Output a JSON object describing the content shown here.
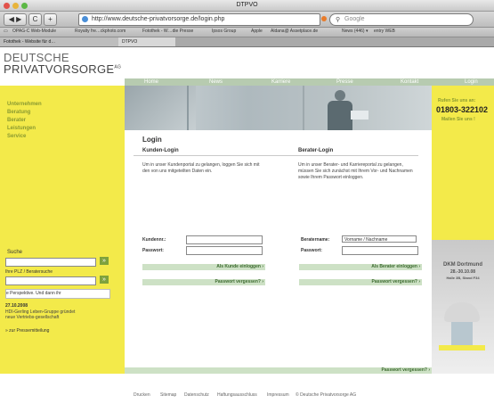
{
  "browser": {
    "window_title": "DTPVO",
    "url": "http://www.deutsche-privatvorsorge.de/login.php",
    "search_placeholder": "Google",
    "back_glyph": "◀ ▶",
    "reload_glyph": "C",
    "add_glyph": "+",
    "bookmarks": [
      "OPAG-C Web-Module",
      "Royalty fre…ckphoto.com",
      "Fotothek - W…die Presse",
      "Ipsos Group",
      "Apple",
      "Aldana@ Assetplace.de",
      "News (446) ▾",
      "entry WEB"
    ],
    "tabs": [
      "Fotothek - Website für d…",
      "DTPVO"
    ]
  },
  "site": {
    "logo_line1": "DEUTSCHE",
    "logo_line2": "PRIVATVORSORGE",
    "logo_sup": "AG",
    "nav": [
      "Home",
      "News",
      "Karriere",
      "Presse",
      "Kontakt",
      "Login"
    ],
    "left_menu": [
      "Unternehmen",
      "Beratung",
      "Berater",
      "Leistungen",
      "Service"
    ],
    "search_label": "Suche",
    "plz_label": "Ihre PLZ / Beratersuche",
    "ticker": "e Perspektive. Und dann ihr",
    "news_date": "27.10.2008",
    "news_text": "HDI-Gerling Leben-Gruppe gründet neue Vertriebs-gesellschaft",
    "news_link": "» zur Pressemitteilung",
    "go_glyph": "»"
  },
  "login": {
    "title": "Login",
    "customer": {
      "heading": "Kunden-Login",
      "text": "Um in unser Kundenportal zu gelangen, loggen Sie sich mit den von uns mitgeteilten Daten ein.",
      "user_label": "Kundennr.:",
      "pass_label": "Passwort:",
      "submit": "Als Kunde einloggen ›",
      "forgot": "Passwort vergessen? ›"
    },
    "advisor": {
      "heading": "Berater-Login",
      "text": "Um in unser Berater- und Karriereportal zu gelangen, müssen Sie sich zunächst mit Ihrem Vor- und Nachnamen sowie Ihrem Passwort einloggen.",
      "user_label": "Beratername:",
      "user_value": "Vorname / Nachname",
      "pass_label": "Passwort:",
      "submit": "Als Berater einloggen ›",
      "forgot": "Passwort vergessen? ›"
    },
    "bottom_forgot": "Passwort vergessen? ›"
  },
  "right": {
    "call": "Rufen Sie uns an:",
    "phone": "01803-322102",
    "mail": "Mailen Sie uns !",
    "event_line1": "DKM Dortmund",
    "event_line2": "28.-30.10.08",
    "event_line3": "Halle 3B, Stand F34"
  },
  "footer": [
    "Drucken",
    "Sitemap",
    "Datenschutz",
    "Haftungsausschluss",
    "Impressum",
    "© Deutsche Privatvorsorge AG"
  ]
}
